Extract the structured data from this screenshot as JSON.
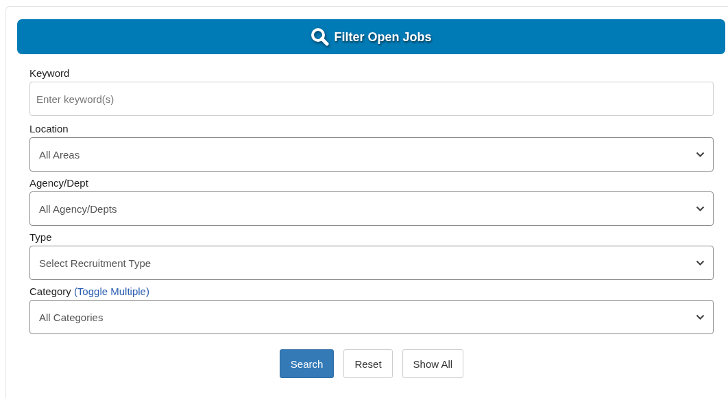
{
  "header": {
    "title": "Filter Open Jobs"
  },
  "fields": [
    {
      "kind": "text",
      "label": "Keyword",
      "placeholder": "Enter keyword(s)"
    },
    {
      "kind": "select",
      "label": "Location",
      "value": "All Areas"
    },
    {
      "kind": "select",
      "label": "Agency/Dept",
      "value": "All Agency/Depts"
    },
    {
      "kind": "select",
      "label": "Type",
      "value": "Select Recruitment Type"
    },
    {
      "kind": "select",
      "label": "Category",
      "link": "(Toggle Multiple)",
      "value": "All Categories"
    }
  ],
  "buttons": [
    {
      "label": "Search",
      "primary": true
    },
    {
      "label": "Reset",
      "primary": false
    },
    {
      "label": "Show All",
      "primary": false
    }
  ]
}
